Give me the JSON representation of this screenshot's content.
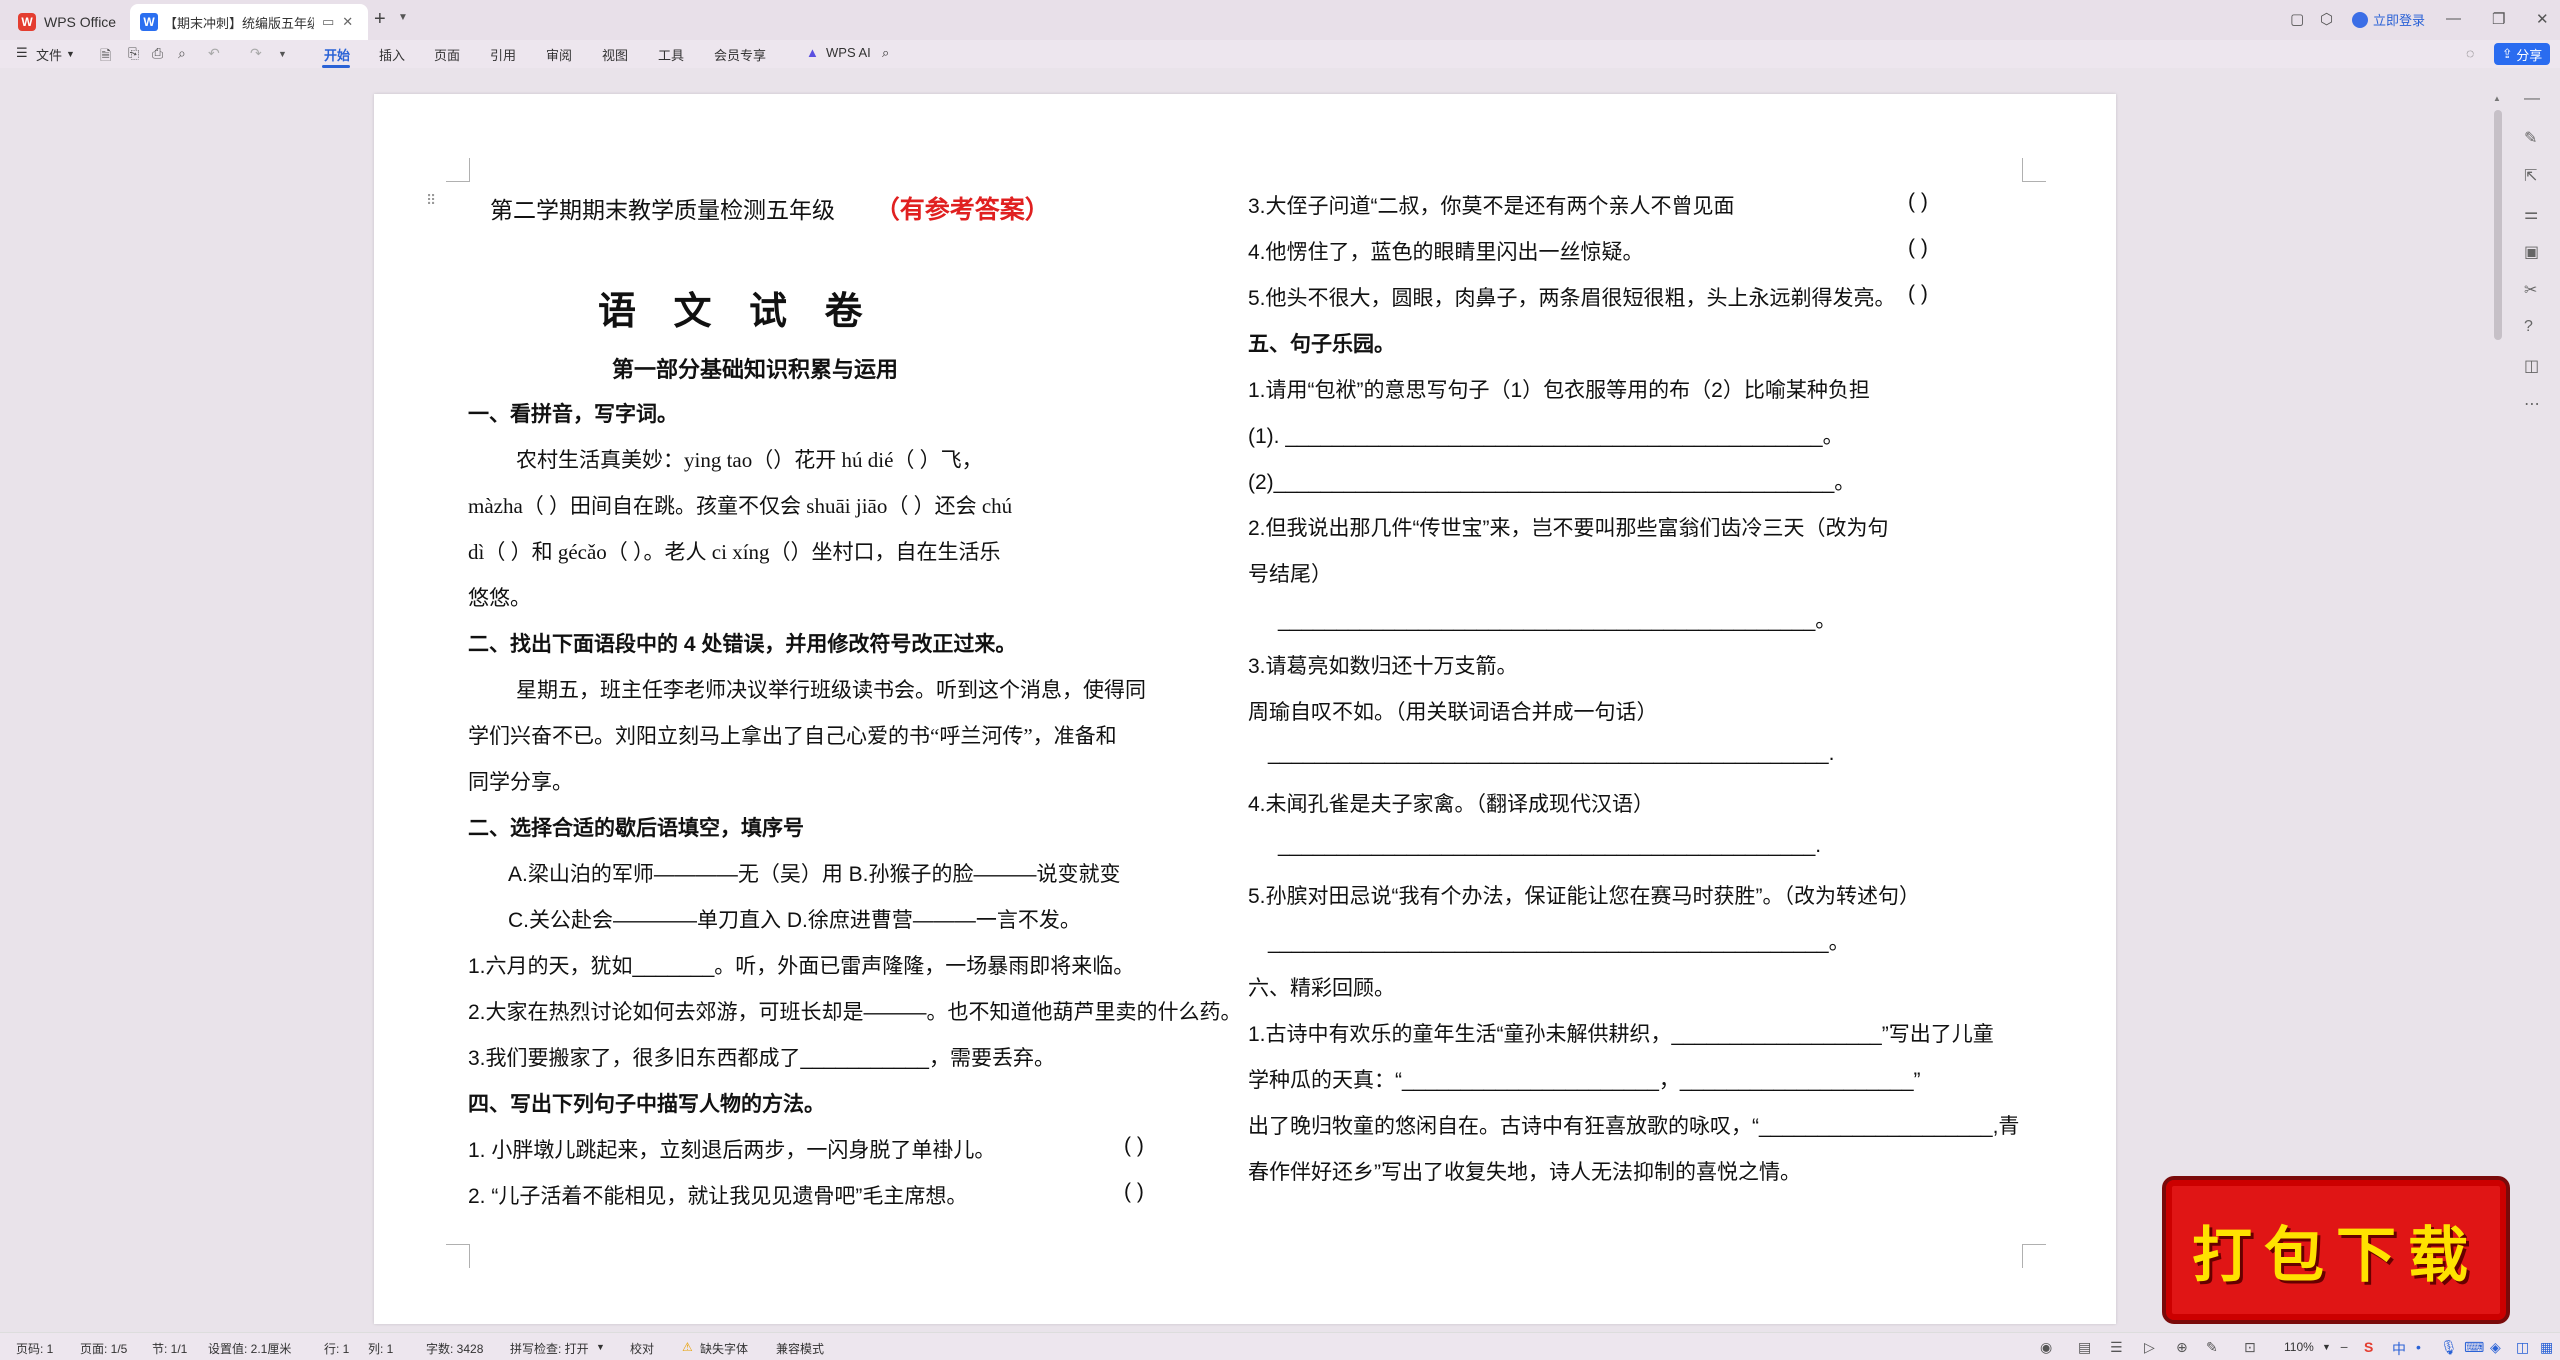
{
  "titlebar": {
    "tabs": [
      {
        "label": "WPS Office"
      },
      {
        "label": "【期末冲刺】统编版五年级语"
      }
    ],
    "login_label": "立即登录"
  },
  "menu": {
    "file": "文件",
    "items": [
      "开始",
      "插入",
      "页面",
      "引用",
      "审阅",
      "视图",
      "工具",
      "会员专享"
    ],
    "wps_ai": "WPS AI",
    "share": "分享"
  },
  "doc": {
    "left": {
      "title_prefix": "第二学期期末教学质量检测五年级",
      "title_suffix": "（有参考答案）",
      "main_title": "语 文 试 卷",
      "part1": "第一部分基础知识积累与运用",
      "q1_head": "一、看拼音，写字词。",
      "q1_l1": "农村生活真美妙：ying tao（）花开 hú dié（            ）飞，",
      "q1_l2": "màzha（          ）田间自在跳。孩童不仅会 shuāi jiāo（          ）还会 chú",
      "q1_l3": "dì（          ）和 gécǎo（              ）。老人 ci xíng（）坐村口，自在生活乐",
      "q1_l4": "悠悠。",
      "q2_head": "二、找出下面语段中的 4 处错误，并用修改符号改正过来。",
      "q2_l1": "星期五，班主任李老师决议举行班级读书会。听到这个消息，使得同",
      "q2_l2": "学们兴奋不已。刘阳立刻马上拿出了自己心爱的书“呼兰河传”，准备和",
      "q2_l3": "同学分享。",
      "q3_head": "二、选择合适的歇后语填空，填序号",
      "q3_opt1": "A.梁山泊的军师————无（吴）用 B.孙猴子的脸———说变就变",
      "q3_opt2": "C.关公赴会————单刀直入 D.徐庶进曹营———一言不发。",
      "q3_s1": "1.六月的天，犹如_______。听，外面已雷声隆隆，一场暴雨即将来临。",
      "q3_s2": "2.大家在热烈讨论如何去郊游，可班长却是———。也不知道他葫芦里卖的什么药。",
      "q3_s3": "3.我们要搬家了，很多旧东西都成了___________，需要丢弃。",
      "q4_head": "四、写出下列句子中描写人物的方法。",
      "q4_s1": "1. 小胖墩儿跳起来，立刻退后两步，一闪身脱了单褂儿。",
      "q4_s2": "2. “儿子活着不能相见，就让我见见遗骨吧”毛主席想。",
      "paren": "(        )"
    },
    "right": {
      "r1": "3.大侄子问道“二叔，你莫不是还有两个亲人不曾见面",
      "r2": "4.他愣住了，蓝色的眼睛里闪出一丝惊疑。",
      "r3": "5.他头不很大，圆眼，肉鼻子，两条眉很短很粗，头上永远剃得发亮。",
      "q5_head": "五、句子乐园。",
      "q5_s1": "1.请用“包袱”的意思写句子（1）包衣服等用的布（2）比喻某种负担",
      "q5_l1": "(1). ______________________________________________。",
      "q5_l2": "(2)________________________________________________。",
      "q5_s2a": "2.但我说出那几件“传世宝”来，岂不要叫那些富翁们齿冷三天（改为句",
      "q5_s2b": "号结尾）",
      "q5_blank2": "______________________________________________。",
      "q5_s3a": "3.请葛亮如数归还十万支箭。",
      "q5_s3b": "周瑜自叹不如。（用关联词语合并成一句话）",
      "q5_blank3": "________________________________________________.",
      "q5_s4": "4.未闻孔雀是夫子家禽。（翻译成现代汉语）",
      "q5_blank4": "______________________________________________.",
      "q5_s5": "5.孙膑对田忌说“我有个办法，保证能让您在赛马时获胜”。（改为转述句）",
      "q5_blank5": "________________________________________________。",
      "q6_head": "六、精彩回顾。",
      "q6_l1": "1.古诗中有欢乐的童年生活“童孙未解供耕织，__________________”写出了儿童",
      "q6_l2": "学种瓜的天真：“______________________，____________________”",
      "q6_l3": "出了晚归牧童的悠闲自在。古诗中有狂喜放歌的咏叹，“____________________,青",
      "q6_l4": "春作伴好还乡”写出了收复失地，诗人无法抑制的喜悦之情。",
      "paren": "(        )"
    }
  },
  "status": {
    "page_num": "页码: 1",
    "pages": "页面: 1/5",
    "section": "节: 1/1",
    "setting": "设置值: 2.1厘米",
    "row": "行: 1",
    "col": "列: 1",
    "wordcount": "字数: 3428",
    "spell": "拼写检查: 打开",
    "proof": "校对",
    "missing_font": "缺失字体",
    "compat": "兼容模式",
    "zoom": "110%"
  },
  "ad": {
    "text": "打包下载"
  },
  "colors": {
    "accent": "#2a62d6",
    "red_title": "#e02020",
    "ad_bg": "#e01515",
    "ad_text": "#ffe200"
  }
}
